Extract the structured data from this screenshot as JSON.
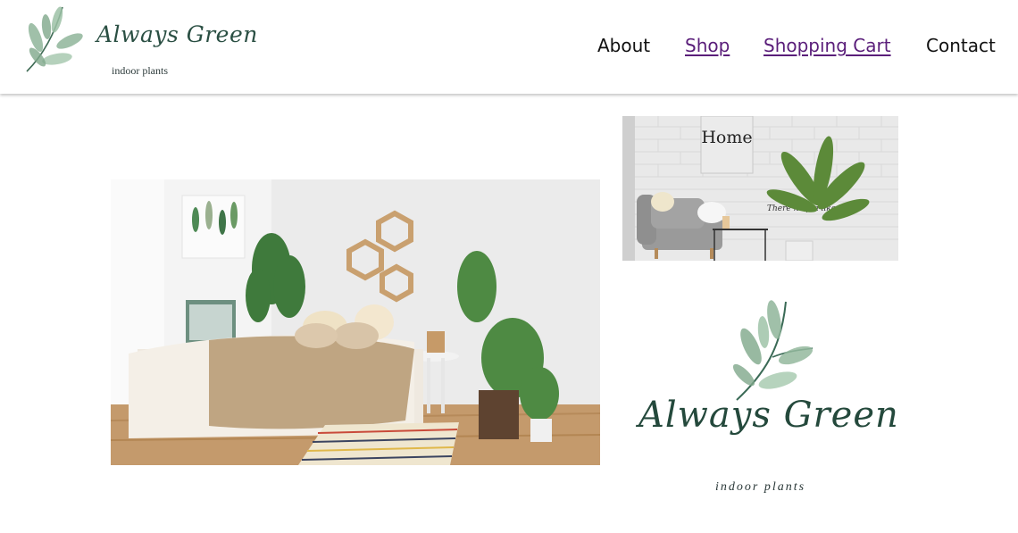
{
  "brand": {
    "name": "Always Green",
    "tagline": "indoor plants"
  },
  "nav": {
    "items": [
      {
        "label": "About",
        "style": "plain"
      },
      {
        "label": "Shop",
        "style": "link"
      },
      {
        "label": "Shopping Cart",
        "style": "link"
      },
      {
        "label": "Contact",
        "style": "plain"
      }
    ]
  },
  "gallery": {
    "home_sign_text": "Home",
    "wall_note": "There no pla like hom"
  },
  "colors": {
    "link": "#5a1e7a",
    "brand_green": "#2a4f43",
    "leaf_green": "#8fb59a"
  }
}
